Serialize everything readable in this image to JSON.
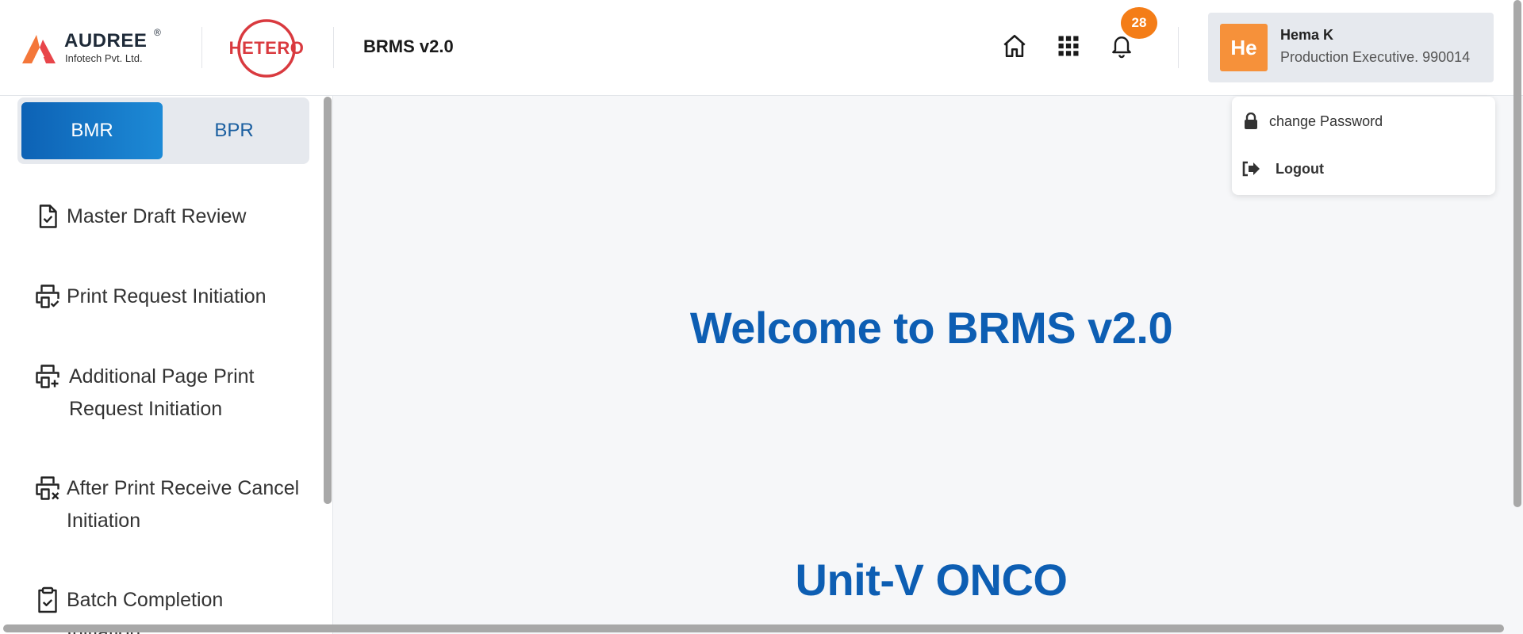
{
  "header": {
    "brand_name": "AUDREE",
    "brand_reg": "®",
    "brand_sub": "Infotech Pvt. Ltd.",
    "partner_name": "HETERO",
    "app_title": "BRMS v2.0",
    "home_icon": "home-icon",
    "apps_icon": "grid-icon",
    "bell_icon": "bell-icon",
    "notification_count": "28"
  },
  "user": {
    "initials": "He",
    "name": "Hema K",
    "role": "Production Executive. 990014"
  },
  "user_menu": {
    "items": [
      {
        "label": "change Password",
        "icon": "lock-icon"
      },
      {
        "label": "Logout",
        "icon": "logout-icon"
      }
    ]
  },
  "sidebar": {
    "toggle": {
      "active": "BMR",
      "inactive": "BPR"
    },
    "items": [
      {
        "label": "Master Draft Review",
        "icon": "file-check-icon"
      },
      {
        "label": "Print Request Initiation",
        "icon": "printer-check-icon"
      },
      {
        "label_line1": "Additional Page Print",
        "label_line2": "Request Initiation",
        "icon": "printer-plus-icon"
      },
      {
        "label_line1": "After Print Receive Cancel",
        "label_line2": "Initiation",
        "icon": "printer-x-icon"
      },
      {
        "label_line1": "Batch Completion",
        "label_line2": "Initiation",
        "icon": "clipboard-check-icon"
      }
    ]
  },
  "main": {
    "welcome": "Welcome to BRMS v2.0",
    "unit": "Unit-V ONCO"
  },
  "colors": {
    "primary": "#0d5eb3",
    "accent_orange": "#f47d17",
    "hetero_red": "#d93a3f"
  }
}
